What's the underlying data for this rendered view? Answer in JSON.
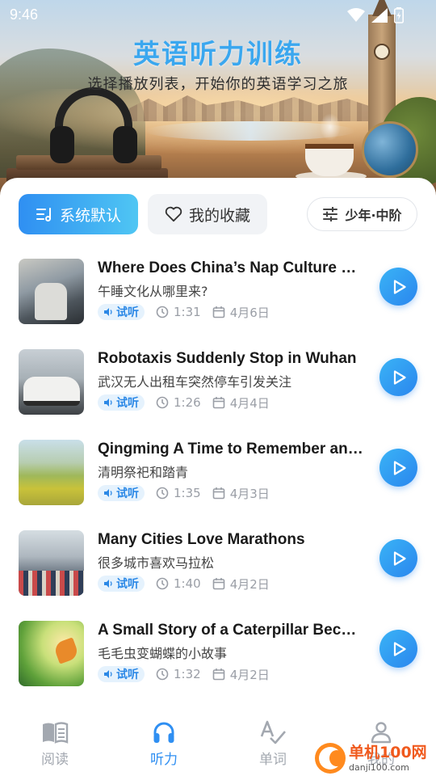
{
  "status_bar": {
    "time": "9:46"
  },
  "header": {
    "title": "英语听力训练",
    "subtitle": "选择播放列表，开始你的英语学习之旅"
  },
  "filters": {
    "default_label": "系统默认",
    "favorites_label": "我的收藏",
    "level_label": "少年·中阶"
  },
  "colors": {
    "accent": "#2f8ff2",
    "accent_light": "#4fc6f3",
    "badge_bg": "#e5f2fd"
  },
  "episodes": [
    {
      "title": "Where Does China’s Nap Culture Come From?",
      "subtitle": "午睡文化从哪里来?",
      "badge": "试听",
      "duration": "1:31",
      "date": "4月6日"
    },
    {
      "title": "Robotaxis Suddenly Stop in Wuhan",
      "subtitle": "武汉无人出租车突然停车引发关注",
      "badge": "试听",
      "duration": "1:26",
      "date": "4月4日"
    },
    {
      "title": "Qingming A Time to Remember and Enjoy",
      "subtitle": "清明祭祀和踏青",
      "badge": "试听",
      "duration": "1:35",
      "date": "4月3日"
    },
    {
      "title": "Many Cities Love Marathons",
      "subtitle": "很多城市喜欢马拉松",
      "badge": "试听",
      "duration": "1:40",
      "date": "4月2日"
    },
    {
      "title": "A Small Story of a Caterpillar Becoming a Butterfly",
      "subtitle": "毛毛虫变蝴蝶的小故事",
      "badge": "试听",
      "duration": "1:32",
      "date": "4月2日"
    }
  ],
  "nav": [
    {
      "label": "阅读",
      "icon": "book-icon"
    },
    {
      "label": "听力",
      "icon": "headphones-icon"
    },
    {
      "label": "单词",
      "icon": "spellcheck-icon"
    },
    {
      "label": "我的",
      "icon": "person-icon"
    }
  ],
  "watermark": {
    "line1": "单机100网",
    "line2": "danji100.com"
  }
}
